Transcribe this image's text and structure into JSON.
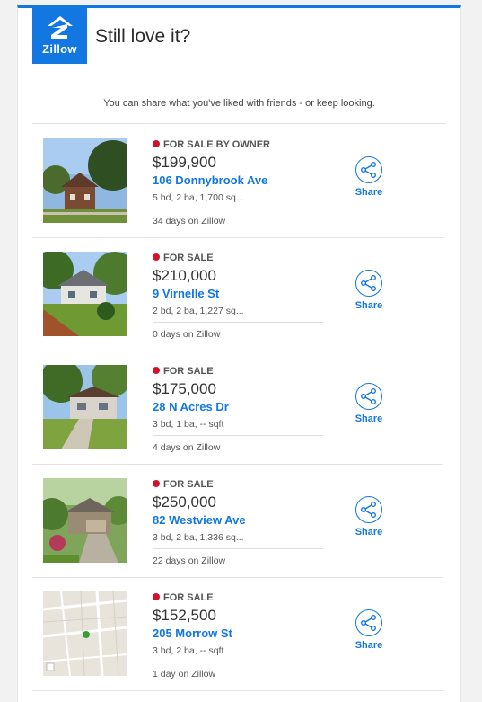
{
  "header": {
    "logo_text": "Zillow",
    "title": "Still love it?"
  },
  "intro": "You can share what you've liked with friends - or keep looking.",
  "accent_color": "#1277e1",
  "status_dot_color": "#d0142c",
  "listings": [
    {
      "status": "FOR SALE BY OWNER",
      "price": "$199,900",
      "address": "106 Donnybrook Ave",
      "facts": "5 bd, 2 ba, 1,700 sq...",
      "days": "34 days on Zillow",
      "share": "Share"
    },
    {
      "status": "FOR SALE",
      "price": "$210,000",
      "address": "9 Virnelle St",
      "facts": "2 bd, 2 ba, 1,227 sq...",
      "days": "0 days on Zillow",
      "share": "Share"
    },
    {
      "status": "FOR SALE",
      "price": "$175,000",
      "address": "28 N Acres Dr",
      "facts": "3 bd, 1 ba, -- sqft",
      "days": "4 days on Zillow",
      "share": "Share"
    },
    {
      "status": "FOR SALE",
      "price": "$250,000",
      "address": "82 Westview Ave",
      "facts": "3 bd, 2 ba, 1,336 sq...",
      "days": "22 days on Zillow",
      "share": "Share"
    },
    {
      "status": "FOR SALE",
      "price": "$152,500",
      "address": "205 Morrow St",
      "facts": "3 bd, 2 ba, -- sqft",
      "days": "1 day on Zillow",
      "share": "Share"
    }
  ]
}
